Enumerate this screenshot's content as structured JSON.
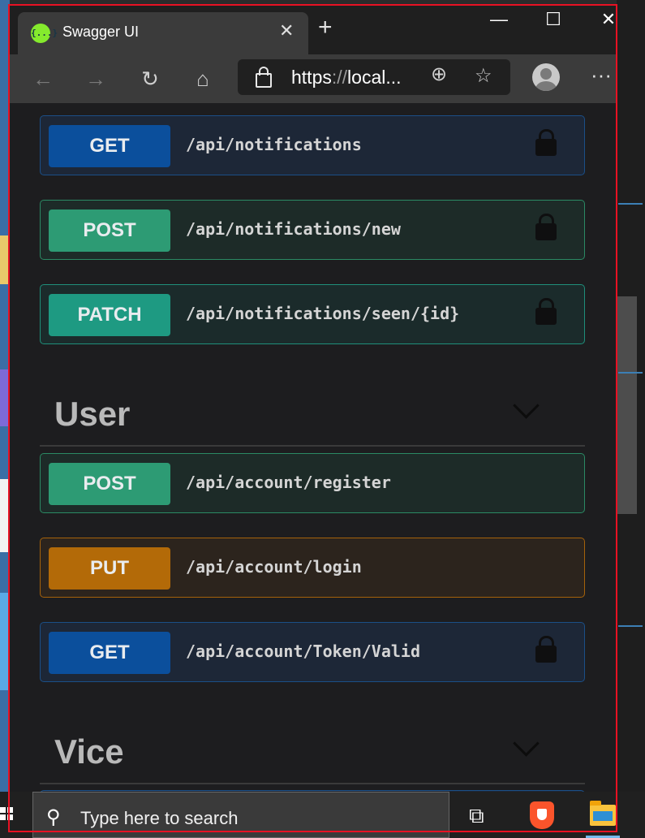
{
  "browser": {
    "tab_title": "Swagger UI",
    "favicon_text": "{...}",
    "tab_close": "✕",
    "new_tab": "+",
    "address_url_scheme": "https",
    "address_url_sep": "://",
    "address_url_rest": "local...",
    "window_controls": {
      "minimize": "—",
      "maximize": "☐",
      "close": "✕"
    },
    "toolbar_icons": {
      "back": "←",
      "forward": "→",
      "refresh": "↻",
      "home": "⌂",
      "zoom": "⊕",
      "favorite": "☆",
      "more": "···"
    }
  },
  "operations_top": [
    {
      "method": "GET",
      "path": "/api/notifications"
    },
    {
      "method": "POST",
      "path": "/api/notifications/new"
    },
    {
      "method": "PATCH",
      "path": "/api/notifications/seen/{id}"
    }
  ],
  "sections": [
    {
      "name": "User",
      "operations": [
        {
          "method": "POST",
          "path": "/api/account/register"
        },
        {
          "method": "PUT",
          "path": "/api/account/login"
        },
        {
          "method": "GET",
          "path": "/api/account/Token/Valid"
        }
      ]
    },
    {
      "name": "Vice"
    }
  ],
  "taskbar": {
    "search_placeholder": "Type here to search",
    "icons": [
      "windows-start-icon",
      "search-icon",
      "task-view-icon",
      "brave-browser-icon",
      "file-explorer-icon"
    ]
  },
  "colors": {
    "get": "#0b4f9c",
    "post": "#2d9b74",
    "patch": "#1e9a82",
    "put": "#b36a08",
    "frame": "#e81123"
  }
}
